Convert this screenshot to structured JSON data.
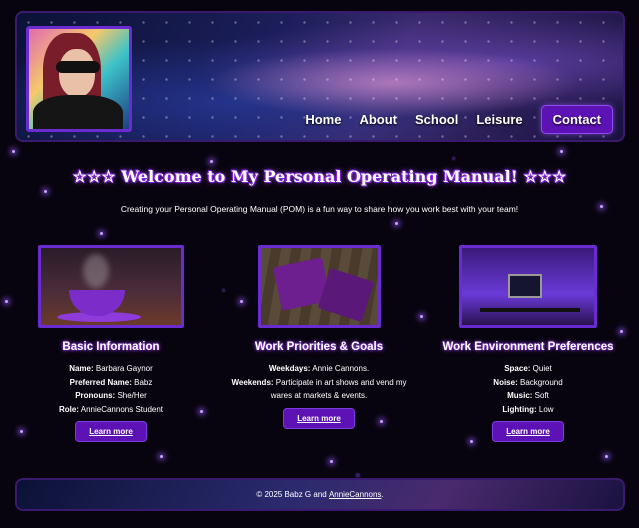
{
  "header": {
    "nav": [
      {
        "label": "Home"
      },
      {
        "label": "About"
      },
      {
        "label": "School"
      },
      {
        "label": "Leisure"
      },
      {
        "label": "Contact"
      }
    ]
  },
  "welcome": {
    "title": "☆☆☆ Welcome to My Personal Operating Manual! ☆☆☆",
    "intro": "Creating your Personal Operating Manual (POM) is a fun way to share how you work best with your team!"
  },
  "cards": [
    {
      "title": "Basic Information",
      "items": [
        {
          "key": "Name:",
          "value": "Barbara Gaynor"
        },
        {
          "key": "Preferred Name:",
          "value": "Babz"
        },
        {
          "key": "Pronouns:",
          "value": "She/Her"
        },
        {
          "key": "Role:",
          "value": "AnnieCannons Student"
        }
      ],
      "button": "Learn more"
    },
    {
      "title": "Work Priorities & Goals",
      "items": [
        {
          "key": "Weekdays:",
          "value": "Annie Cannons."
        },
        {
          "key": "Weekends:",
          "value": "Participate in art shows and vend my wares at markets & events."
        }
      ],
      "button": "Learn more"
    },
    {
      "title": "Work Environment Preferences",
      "items": [
        {
          "key": "Space:",
          "value": "Quiet"
        },
        {
          "key": "Noise:",
          "value": "Background"
        },
        {
          "key": "Music:",
          "value": "Soft"
        },
        {
          "key": "Lighting:",
          "value": "Low"
        }
      ],
      "button": "Learn more"
    }
  ],
  "footer": {
    "prefix": "© 2025 Babz G and ",
    "link": "AnnieCannons",
    "suffix": "."
  },
  "colors": {
    "accent": "#5d12b5",
    "border": "#6a2bd0",
    "background": "#08040f"
  }
}
